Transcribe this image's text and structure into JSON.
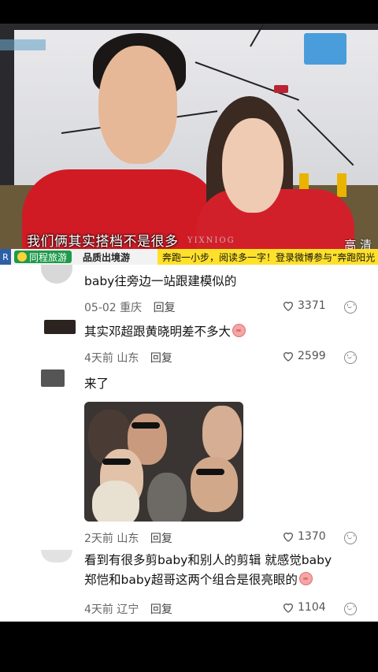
{
  "video": {
    "subtitle": "我们俩其实搭档不是很多",
    "watermark": "YIXNIOG",
    "corner_tag": "高 清",
    "ticker": {
      "r_tag": "R",
      "logo_text": "同程旅游",
      "slogan": "品质出境游",
      "news": "奔跑一小步，阅读多一字！登录微博参与“奔跑阳光"
    }
  },
  "comments": [
    {
      "text": "baby往旁边一站跟建模似的",
      "date": "05-02",
      "location": "重庆",
      "reply": "回复",
      "likes": "3371"
    },
    {
      "text": "其实邓超跟黄晓明差不多大",
      "emoji": "pig-face-emoji",
      "date": "4天前",
      "location": "山东",
      "reply": "回复",
      "likes": "2599"
    },
    {
      "text": "来了",
      "has_image": true,
      "date": "2天前",
      "location": "山东",
      "reply": "回复",
      "likes": "1370"
    },
    {
      "text_line1": "看到有很多剪baby和别人的剪辑  就感觉baby",
      "text_line2": "郑恺和baby超哥这两个组合是很亮眼的",
      "emoji": "pig-face-emoji",
      "date": "4天前",
      "location": "辽宁",
      "reply": "回复",
      "likes": "1104"
    }
  ],
  "colors": {
    "jersey_red": "#d01b25",
    "ticker_yellow": "#ffe12b",
    "brand_green": "#1e9a4a"
  }
}
